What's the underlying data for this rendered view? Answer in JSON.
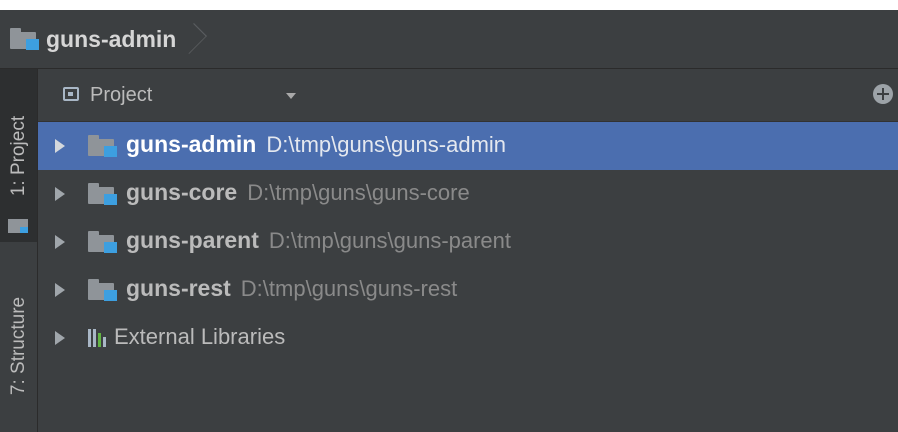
{
  "navbar": {
    "module": "guns-admin"
  },
  "sidebar": {
    "tabs": [
      {
        "label": "1: Project",
        "active": true
      },
      {
        "label": "7: Structure",
        "active": false
      }
    ]
  },
  "project_panel": {
    "view_label": "Project",
    "icons": {
      "view": "project-view-icon",
      "dropdown": "caret-down-icon",
      "locate": "target-icon"
    }
  },
  "tree": {
    "modules": [
      {
        "name": "guns-admin",
        "path": "D:\\tmp\\guns\\guns-admin",
        "selected": true
      },
      {
        "name": "guns-core",
        "path": "D:\\tmp\\guns\\guns-core",
        "selected": false
      },
      {
        "name": "guns-parent",
        "path": "D:\\tmp\\guns\\guns-parent",
        "selected": false
      },
      {
        "name": "guns-rest",
        "path": "D:\\tmp\\guns\\guns-rest",
        "selected": false
      }
    ],
    "libraries": {
      "label": "External Libraries"
    }
  },
  "colors": {
    "panel_bg": "#3c3f41",
    "selection": "#4b6eaf",
    "module_badge": "#3d9fe0",
    "text": "#bbbbbb",
    "path_text": "#8a8a8a"
  }
}
